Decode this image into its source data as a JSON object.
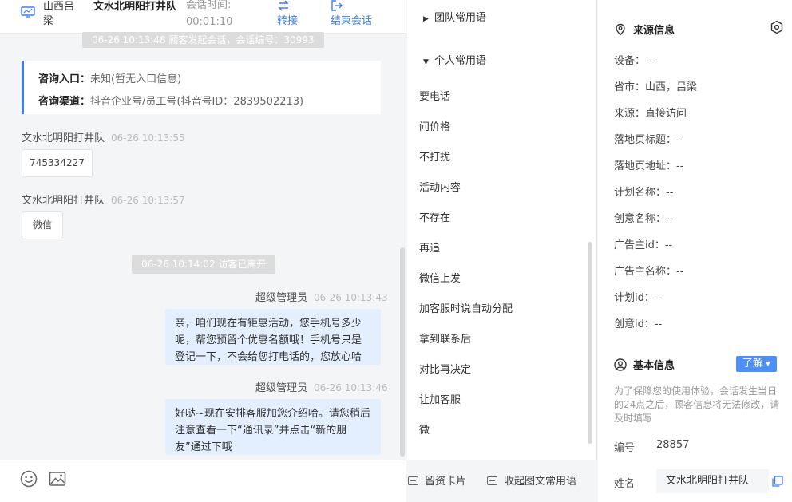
{
  "header": {
    "location": "山西吕梁",
    "visitor_name": "文水北明阳打井队",
    "time_label": "会话时间:",
    "time_value": "00:01:10",
    "transfer_label": "转接",
    "end_label": "结束会话"
  },
  "chat": {
    "session_start": "06-26 10:13:48 顾客发起会话，会话编号：30993",
    "entry": {
      "key": "咨询入口：",
      "value": "未知(暂无入口信息)"
    },
    "channel": {
      "key": "咨询渠道：",
      "value": "抖音企业号/员工号(抖音号ID：2839502213)"
    },
    "messages": [
      {
        "sender": "文水北明阳打井队",
        "time": "06-26 10:13:55",
        "text": "745334227"
      },
      {
        "sender": "文水北明阳打井队",
        "time": "06-26 10:13:57",
        "text": "微信"
      }
    ],
    "visitor_left": "06-26 10:14:02 访客已离开",
    "replies": [
      {
        "sender": "超级管理员",
        "time": "06-26 10:13:43",
        "text": "亲，咱们现在有钜惠活动，您手机号多少呢，帮您预留个优惠名额哦！手机号只是登记一下，不会给您打电话的，您放心哈"
      },
      {
        "sender": "超级管理员",
        "time": "06-26 10:13:46",
        "text": "好哒~现在安排客服加您介绍哈。请您稍后注意查看一下“通讯录”并点击“新的朋友”通过下哦"
      }
    ]
  },
  "footer": {
    "emoji_icon": "smile-icon",
    "image_icon": "image-icon",
    "card_label": "留资卡片",
    "collapse_label": "收起图文常用语"
  },
  "phrases": {
    "team_group": "团队常用语",
    "personal_group": "个人常用语",
    "items": [
      "要电话",
      "问价格",
      "不打扰",
      "活动内容",
      "不存在",
      "再追",
      "微信上发",
      "加客服时说自动分配",
      "拿到联系后",
      "对比再决定",
      "让加客服",
      "微"
    ]
  },
  "side": {
    "source_title": "来源信息",
    "fields": [
      "设备：--",
      "省市：山西，吕梁",
      "来源：直接访问",
      "落地页标题：--",
      "落地页地址：--",
      "计划名称：--",
      "创意名称：--",
      "广告主id：--",
      "广告主名称：--",
      "计划id：--",
      "创意id：--"
    ],
    "basic_title": "基本信息",
    "learn_label": "了解",
    "note": "为了保障您的使用体验，会话发生当日的24点之后，顾客信息将无法修改，请及时填写",
    "id_label": "编号",
    "id_value": "28857",
    "name_label": "姓名",
    "name_value": "文水北明阳打井队"
  },
  "colors": {
    "accent": "#3f7ef1",
    "bubble": "#e3efff",
    "pill": "#dcdcdc"
  }
}
